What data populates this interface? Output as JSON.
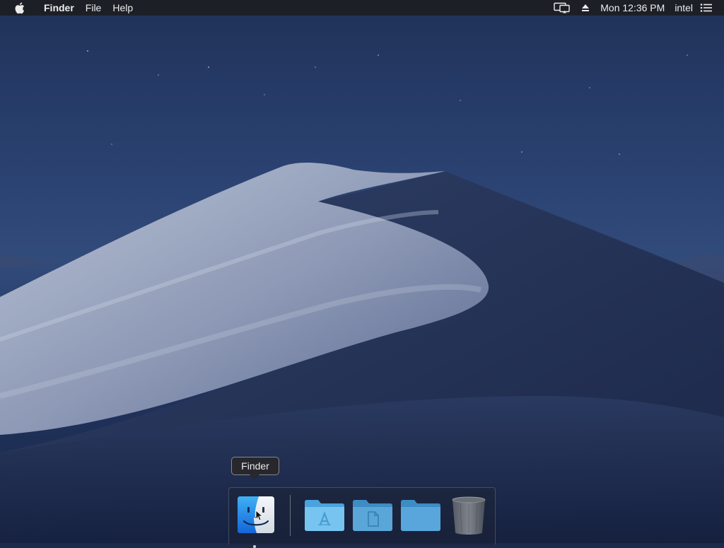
{
  "menubar": {
    "apple_icon": "apple-icon",
    "app_name": "Finder",
    "items": [
      "File",
      "Help"
    ],
    "status": {
      "airplay_icon": "airplay-display-icon",
      "eject_icon": "eject-icon",
      "clock": "Mon 12:36 PM",
      "user": "intel",
      "menu_icon": "list-icon"
    }
  },
  "desktop": {
    "wallpaper": "desert-dune-night"
  },
  "dock": {
    "items": [
      {
        "name": "Finder",
        "icon": "finder-icon",
        "running": true
      },
      {
        "name": "Applications",
        "icon": "applications-folder-icon",
        "running": false
      },
      {
        "name": "Documents",
        "icon": "documents-folder-icon",
        "running": false
      },
      {
        "name": "Folder",
        "icon": "folder-icon",
        "running": false
      },
      {
        "name": "Trash",
        "icon": "trash-icon",
        "running": false
      }
    ]
  },
  "tooltip": {
    "text": "Finder"
  },
  "colors": {
    "menubar_bg": "#1c1e22",
    "folder_blue": "#5fb3e6",
    "finder_blue": "#1e90e8"
  }
}
